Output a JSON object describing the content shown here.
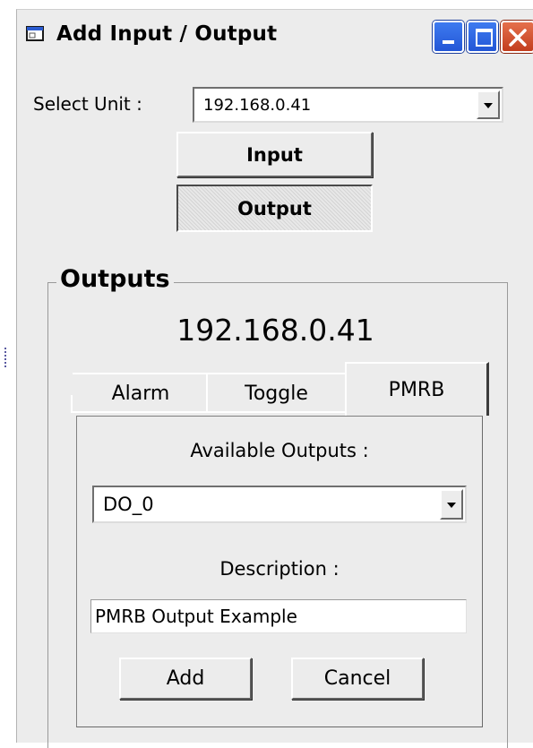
{
  "window": {
    "title": "Add Input / Output",
    "icon": "app-window-icon",
    "controls": [
      "minimize-icon",
      "maximize-icon",
      "close-icon"
    ]
  },
  "unit": {
    "label": "Select Unit :",
    "selected": "192.168.0.41"
  },
  "mode_buttons": {
    "input_label": "Input",
    "output_label": "Output",
    "active": "Output"
  },
  "outputs": {
    "group_title": "Outputs",
    "ip": "192.168.0.41",
    "tabs": [
      {
        "label": "Alarm"
      },
      {
        "label": "Toggle"
      },
      {
        "label": "PMRB"
      }
    ],
    "active_tab": "PMRB",
    "available_label": "Available Outputs :",
    "available_selected": "DO_0",
    "description_label": "Description :",
    "description_value": "PMRB Output Example",
    "add_label": "Add",
    "cancel_label": "Cancel"
  },
  "colors": {
    "window_bg": "#ececec",
    "titlebar_button_blue": "#2f66e3",
    "close_button_red": "#d2512e"
  }
}
